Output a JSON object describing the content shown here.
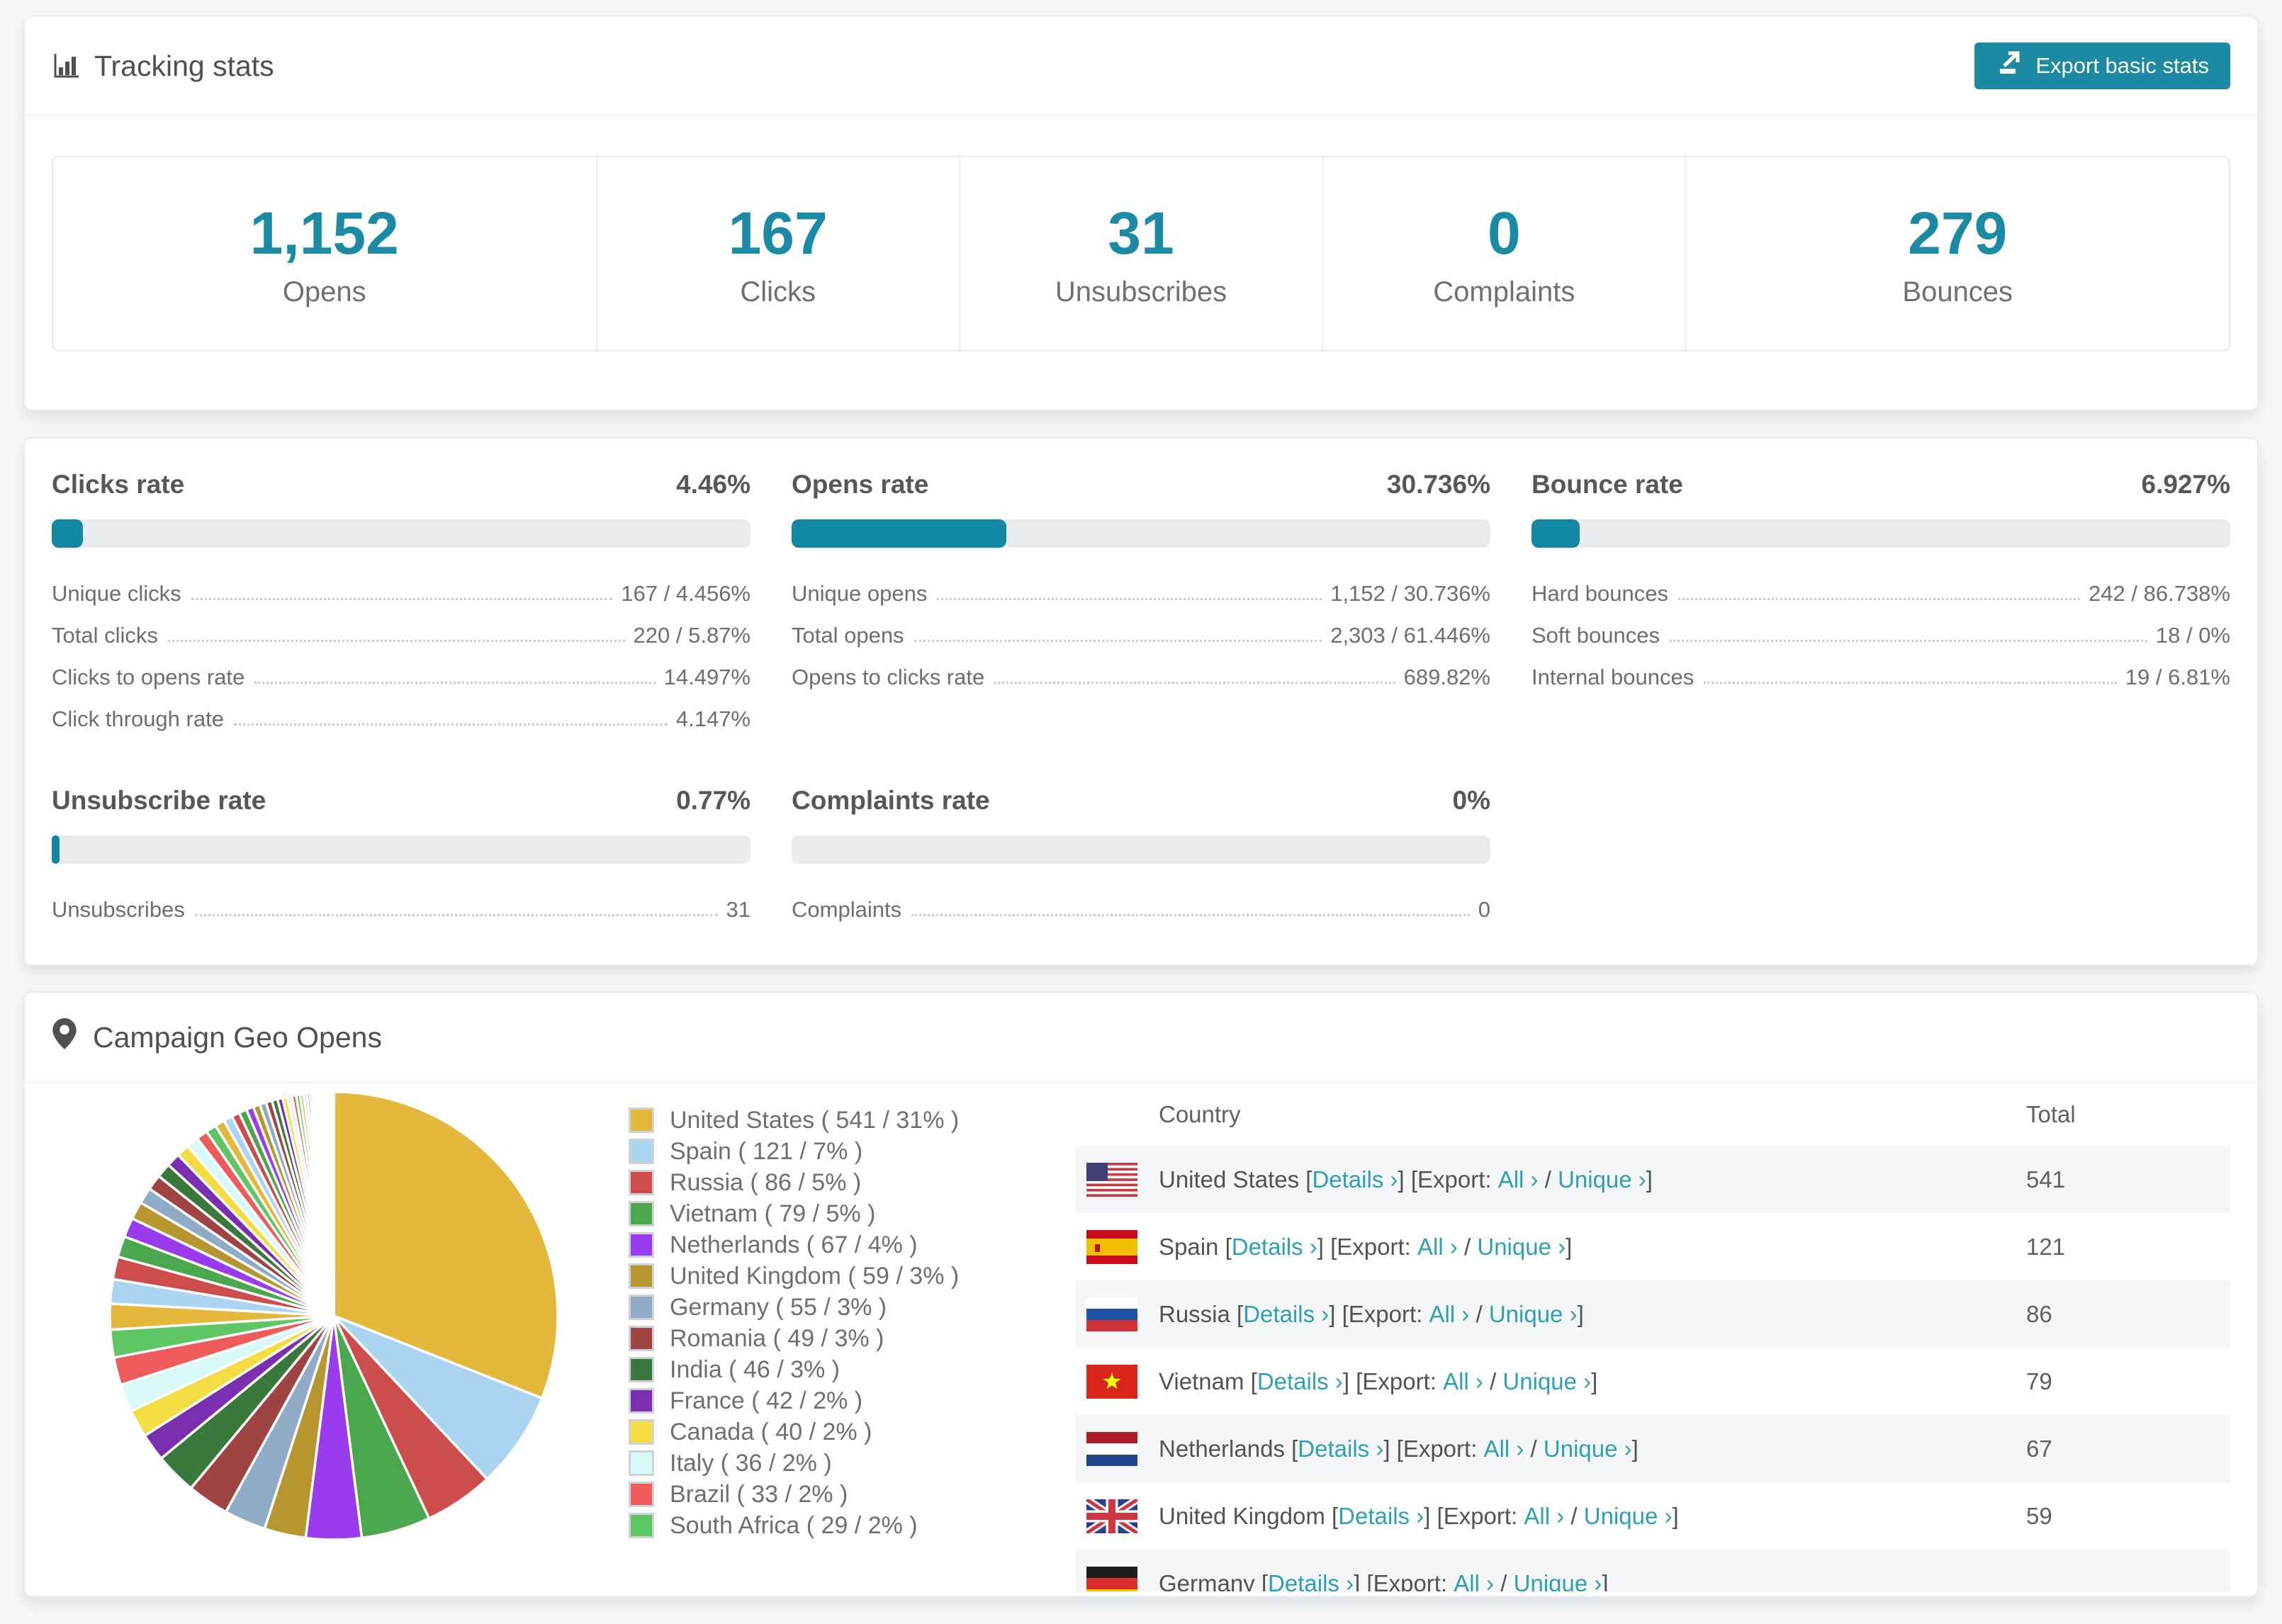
{
  "colors": {
    "primary": "#1b8aa2",
    "bar_fill": "#1187a1",
    "accent_text": "#1b8ba5",
    "link": "#2e9fb9"
  },
  "icons": {
    "header": "bar-chart-icon",
    "export": "export-icon",
    "geo": "map-pin-icon"
  },
  "tracking": {
    "title": "Tracking stats",
    "export_button": "Export basic stats",
    "stats": [
      {
        "value": "1,152",
        "label": "Opens"
      },
      {
        "value": "167",
        "label": "Clicks"
      },
      {
        "value": "31",
        "label": "Unsubscribes"
      },
      {
        "value": "0",
        "label": "Complaints"
      },
      {
        "value": "279",
        "label": "Bounces"
      }
    ]
  },
  "rates": {
    "blocks": [
      {
        "title": "Clicks rate",
        "value": "4.46%",
        "pct": 4.46,
        "rows": [
          [
            "Unique clicks",
            "167 / 4.456%"
          ],
          [
            "Total clicks",
            "220 / 5.87%"
          ],
          [
            "Clicks to opens rate",
            "14.497%"
          ],
          [
            "Click through rate",
            "4.147%"
          ]
        ]
      },
      {
        "title": "Opens rate",
        "value": "30.736%",
        "pct": 30.736,
        "rows": [
          [
            "Unique opens",
            "1,152 / 30.736%"
          ],
          [
            "Total opens",
            "2,303 / 61.446%"
          ],
          [
            "Opens to clicks rate",
            "689.82%"
          ]
        ]
      },
      {
        "title": "Bounce rate",
        "value": "6.927%",
        "pct": 6.927,
        "rows": [
          [
            "Hard bounces",
            "242 / 86.738%"
          ],
          [
            "Soft bounces",
            "18 / 0%"
          ],
          [
            "Internal bounces",
            "19 / 6.81%"
          ]
        ]
      },
      {
        "title": "Unsubscribe rate",
        "value": "0.77%",
        "pct": 0.77,
        "rows": [
          [
            "Unsubscribes",
            "31"
          ]
        ]
      },
      {
        "title": "Complaints rate",
        "value": "0%",
        "pct": 0,
        "rows": [
          [
            "Complaints",
            "0"
          ]
        ]
      }
    ]
  },
  "geo": {
    "title": "Campaign Geo Opens",
    "table": {
      "headers": [
        "Country",
        "Total"
      ],
      "chevron": "›",
      "details_label": "Details",
      "export_label": "Export:",
      "all_label": "All",
      "unique_label": "Unique",
      "rows": [
        {
          "country": "United States",
          "flag": "us",
          "total": "541"
        },
        {
          "country": "Spain",
          "flag": "es",
          "total": "121"
        },
        {
          "country": "Russia",
          "flag": "ru",
          "total": "86"
        },
        {
          "country": "Vietnam",
          "flag": "vn",
          "total": "79"
        },
        {
          "country": "Netherlands",
          "flag": "nl",
          "total": "67"
        },
        {
          "country": "United Kingdom",
          "flag": "gb",
          "total": "59"
        },
        {
          "country": "Germany",
          "flag": "de",
          "total": ""
        }
      ]
    }
  },
  "chart_data": {
    "type": "pie",
    "title": "Campaign Geo Opens",
    "unit": "opens",
    "start_angle_deg": 0,
    "direction": "clockwise",
    "legend_position": "right",
    "slices": [
      {
        "name": "United States",
        "value": 541,
        "pct": 31,
        "color": "#e3b83b"
      },
      {
        "name": "Spain",
        "value": 121,
        "pct": 7,
        "color": "#abd4f0"
      },
      {
        "name": "Russia",
        "value": 86,
        "pct": 5,
        "color": "#cd4d4d"
      },
      {
        "name": "Vietnam",
        "value": 79,
        "pct": 5,
        "color": "#4aa74d"
      },
      {
        "name": "Netherlands",
        "value": 67,
        "pct": 4,
        "color": "#9b3bf0"
      },
      {
        "name": "United Kingdom",
        "value": 59,
        "pct": 3,
        "color": "#b8962f"
      },
      {
        "name": "Germany",
        "value": 55,
        "pct": 3,
        "color": "#8fabc6"
      },
      {
        "name": "Romania",
        "value": 49,
        "pct": 3,
        "color": "#a04343"
      },
      {
        "name": "India",
        "value": 46,
        "pct": 3,
        "color": "#39793c"
      },
      {
        "name": "France",
        "value": 42,
        "pct": 2,
        "color": "#7a2fb0"
      },
      {
        "name": "Canada",
        "value": 40,
        "pct": 2,
        "color": "#f3dd43"
      },
      {
        "name": "Italy",
        "value": 36,
        "pct": 2,
        "color": "#d9f8f8"
      },
      {
        "name": "Brazil",
        "value": 33,
        "pct": 2,
        "color": "#ef5a5a"
      },
      {
        "name": "South Africa",
        "value": 29,
        "pct": 2,
        "color": "#5ec763"
      }
    ],
    "others_total_pct": 26,
    "others_fan_pcts": [
      1.86,
      1.75,
      1.63,
      1.51,
      1.4,
      1.28,
      1.17,
      1.11,
      1.05,
      0.99,
      0.93,
      0.87,
      0.82,
      0.76,
      0.7,
      0.64,
      0.58,
      0.56,
      0.52,
      0.49,
      0.47,
      0.44,
      0.41,
      0.37,
      0.35,
      0.33,
      0.3,
      0.28,
      0.26,
      0.23,
      0.21,
      0.19,
      0.17,
      0.16,
      0.15,
      0.14,
      0.13,
      0.12,
      0.1,
      0.09,
      0.08,
      0.07,
      0.06,
      0.06,
      0.05,
      0.05,
      0.03,
      0.03,
      0.02,
      0.02
    ]
  }
}
